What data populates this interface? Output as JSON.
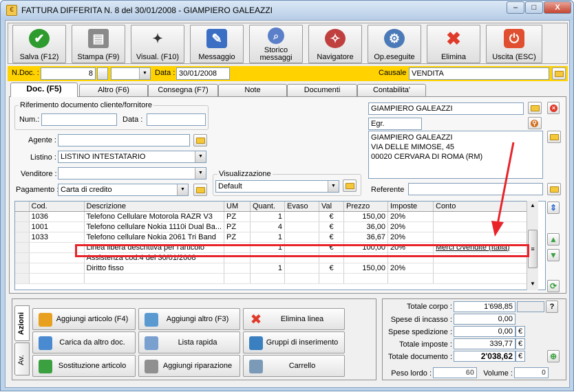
{
  "window": {
    "title": "FATTURA DIFFERITA N. 8  del 30/01/2008 - GIAMPIERO GALEAZZI",
    "minimize": "–",
    "maximize": "□",
    "close": "X"
  },
  "toolbar": [
    {
      "label": "Salva (F12)",
      "icon": "check-icon",
      "color": "#2e9b2e"
    },
    {
      "label": "Stampa (F9)",
      "icon": "printer-icon",
      "color": "#8a8a8a"
    },
    {
      "label": "Visual. (F10)",
      "icon": "magic-wand-icon",
      "color": "#3b3b3b"
    },
    {
      "label": "Messaggio",
      "icon": "pen-icon",
      "color": "#3a6fc4"
    },
    {
      "label": "Storico messaggi",
      "icon": "search-icon",
      "color": "#5b7fc8"
    },
    {
      "label": "Navigatore",
      "icon": "compass-icon",
      "color": "#c04040"
    },
    {
      "label": "Op.eseguite",
      "icon": "gears-icon",
      "color": "#4a7ab8"
    },
    {
      "label": "Elimina",
      "icon": "delete-x-icon",
      "color": "#e03a2a"
    },
    {
      "label": "Uscita (ESC)",
      "icon": "exit-icon",
      "color": "#e05030"
    }
  ],
  "docbar": {
    "ndoc_label": "N.Doc. :",
    "ndoc_value": "8",
    "data_label": "Data :",
    "data_value": "30/01/2008",
    "causale_label": "Causale :",
    "causale_value": "VENDITA"
  },
  "tabs": [
    "Doc. (F5)",
    "Altro (F6)",
    "Consegna (F7)",
    "Note",
    "Documenti",
    "Contabilita'"
  ],
  "riferimento": {
    "title": "Riferimento documento cliente/fornitore",
    "num_label": "Num.:",
    "data_label": "Data :"
  },
  "form": {
    "agente_label": "Agente :",
    "listino_label": "Listino :",
    "listino_value": "LISTINO INTESTATARIO",
    "venditore_label": "Venditore :",
    "pagamento_label": "Pagamento :",
    "pagamento_value": "Carta di credito",
    "visualizzazione_label": "Visualizzazione",
    "visualizzazione_value": "Default"
  },
  "cliente": {
    "name": "GIAMPIERO GALEAZZI",
    "title": "Egr.",
    "address_lines": [
      "GIAMPIERO GALEAZZI",
      "VIA DELLE MIMOSE, 45",
      "00020 CERVARA DI ROMA (RM)"
    ],
    "referente_label": "Referente"
  },
  "grid": {
    "headers": [
      "Cod.",
      "Descrizione",
      "UM",
      "Quant.",
      "Evaso",
      "Val",
      "Prezzo",
      "Imposte",
      "Conto"
    ],
    "rows": [
      [
        "1036",
        "Telefono Cellulare Motorola RAZR V3",
        "PZ",
        "1",
        "",
        "€",
        "150,00",
        "20%",
        ""
      ],
      [
        "1001",
        "Telefono cellulare Nokia 1110i Dual Ba...",
        "PZ",
        "4",
        "",
        "€",
        "36,00",
        "20%",
        ""
      ],
      [
        "1033",
        "Telefono cellulare Nokia 2061 Tri Band",
        "PZ",
        "1",
        "",
        "€",
        "36,67",
        "20%",
        ""
      ],
      [
        "",
        "Linea libera descrittiva per l'articolo",
        "",
        "1",
        "",
        "€",
        "100,00",
        "20%",
        "Merci c/vendite (Italia)"
      ],
      [
        "",
        "Assistenza cod.4 del 30/01/2008",
        "",
        "",
        "",
        "",
        "",
        "",
        ""
      ],
      [
        "",
        "Diritto fisso",
        "",
        "1",
        "",
        "€",
        "150,00",
        "20%",
        ""
      ],
      [
        "",
        "",
        "",
        "",
        "",
        "",
        "",
        "",
        ""
      ]
    ]
  },
  "actions": {
    "tab_azioni": "Azioni",
    "tab_av": "Av.",
    "buttons": [
      {
        "label": "Aggiungi articolo (F4)",
        "icon": "add-article-icon",
        "color": "#e8a020"
      },
      {
        "label": "Aggiungi altro (F3)",
        "icon": "add-other-icon",
        "color": "#5a9ad0"
      },
      {
        "label": "Elimina linea",
        "icon": "delete-line-icon",
        "color": "#e03a2a"
      },
      {
        "label": "Carica da altro doc.",
        "icon": "load-doc-icon",
        "color": "#4a8ad0"
      },
      {
        "label": "Lista rapida",
        "icon": "quick-list-icon",
        "color": "#7aa0d0"
      },
      {
        "label": "Gruppi di inserimento",
        "icon": "groups-icon",
        "color": "#3a80c0"
      },
      {
        "label": "Sostituzione articolo",
        "icon": "replace-article-icon",
        "color": "#3aa040"
      },
      {
        "label": "Aggiungi riparazione",
        "icon": "wrench-icon",
        "color": "#909090"
      },
      {
        "label": "Carrello",
        "icon": "cart-icon",
        "color": "#7a9ab8"
      }
    ]
  },
  "totals": {
    "totale_corpo_label": "Totale corpo :",
    "totale_corpo": "1'698,85",
    "spese_incasso_label": "Spese di incasso :",
    "spese_incasso": "0,00",
    "spese_spedizione_label": "Spese spedizione :",
    "spese_spedizione": "0,00",
    "totale_imposte_label": "Totale imposte :",
    "totale_imposte": "339,77",
    "totale_documento_label": "Totale documento :",
    "totale_documento": "2'038,62",
    "currency": "€",
    "help": "?",
    "peso_label": "Peso lordo :",
    "peso_value": "60",
    "volume_label": "Volume :",
    "volume_value": "0"
  }
}
